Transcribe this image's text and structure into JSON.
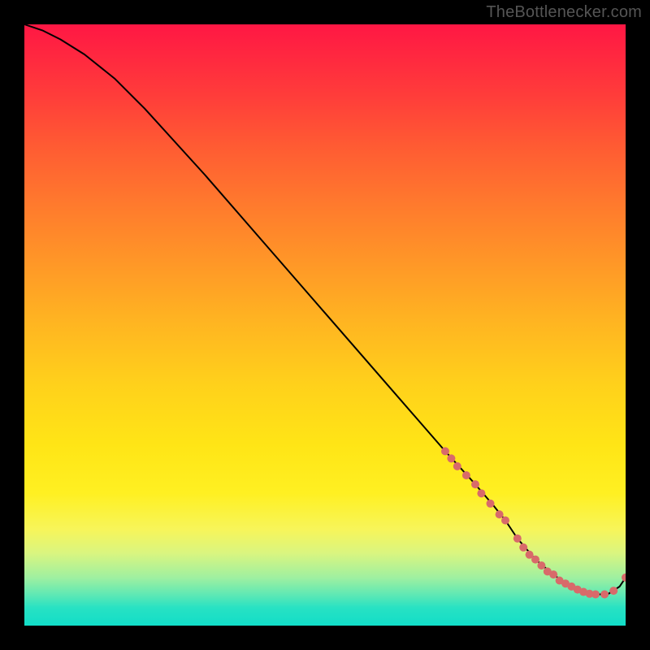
{
  "attribution": "TheBottlenecker.com",
  "colors": {
    "background": "#000000",
    "gradient_top": "#ff1744",
    "gradient_bottom": "#12ddc8",
    "curve": "#000000",
    "marker": "#d86a6a"
  },
  "chart_data": {
    "type": "line",
    "title": "",
    "xlabel": "",
    "ylabel": "",
    "xlim": [
      0,
      100
    ],
    "ylim": [
      0,
      100
    ],
    "curve": {
      "x": [
        0,
        3,
        6,
        10,
        15,
        20,
        30,
        40,
        50,
        60,
        70,
        75,
        78,
        80,
        82,
        85,
        88,
        90,
        92,
        95,
        97,
        99,
        100
      ],
      "y": [
        100,
        99,
        97.5,
        95,
        91,
        86,
        75,
        63.5,
        52,
        40.5,
        29,
        23.5,
        20,
        17.5,
        14.5,
        11,
        8.5,
        7,
        6,
        5.2,
        5.2,
        6.5,
        8
      ]
    },
    "markers": [
      {
        "x": 70,
        "y": 29
      },
      {
        "x": 71,
        "y": 27.8
      },
      {
        "x": 72,
        "y": 26.5
      },
      {
        "x": 73.5,
        "y": 25
      },
      {
        "x": 75,
        "y": 23.5
      },
      {
        "x": 76,
        "y": 22
      },
      {
        "x": 77.5,
        "y": 20.3
      },
      {
        "x": 79,
        "y": 18.5
      },
      {
        "x": 80,
        "y": 17.5
      },
      {
        "x": 82,
        "y": 14.5
      },
      {
        "x": 83,
        "y": 13
      },
      {
        "x": 84,
        "y": 11.8
      },
      {
        "x": 85,
        "y": 11
      },
      {
        "x": 86,
        "y": 10
      },
      {
        "x": 87,
        "y": 9
      },
      {
        "x": 88,
        "y": 8.5
      },
      {
        "x": 89,
        "y": 7.5
      },
      {
        "x": 90,
        "y": 7
      },
      {
        "x": 91,
        "y": 6.5
      },
      {
        "x": 92,
        "y": 6
      },
      {
        "x": 93,
        "y": 5.6
      },
      {
        "x": 94,
        "y": 5.3
      },
      {
        "x": 95,
        "y": 5.2
      },
      {
        "x": 96.5,
        "y": 5.2
      },
      {
        "x": 98,
        "y": 5.8
      },
      {
        "x": 100,
        "y": 8
      }
    ],
    "marker_radius_px": 5
  }
}
